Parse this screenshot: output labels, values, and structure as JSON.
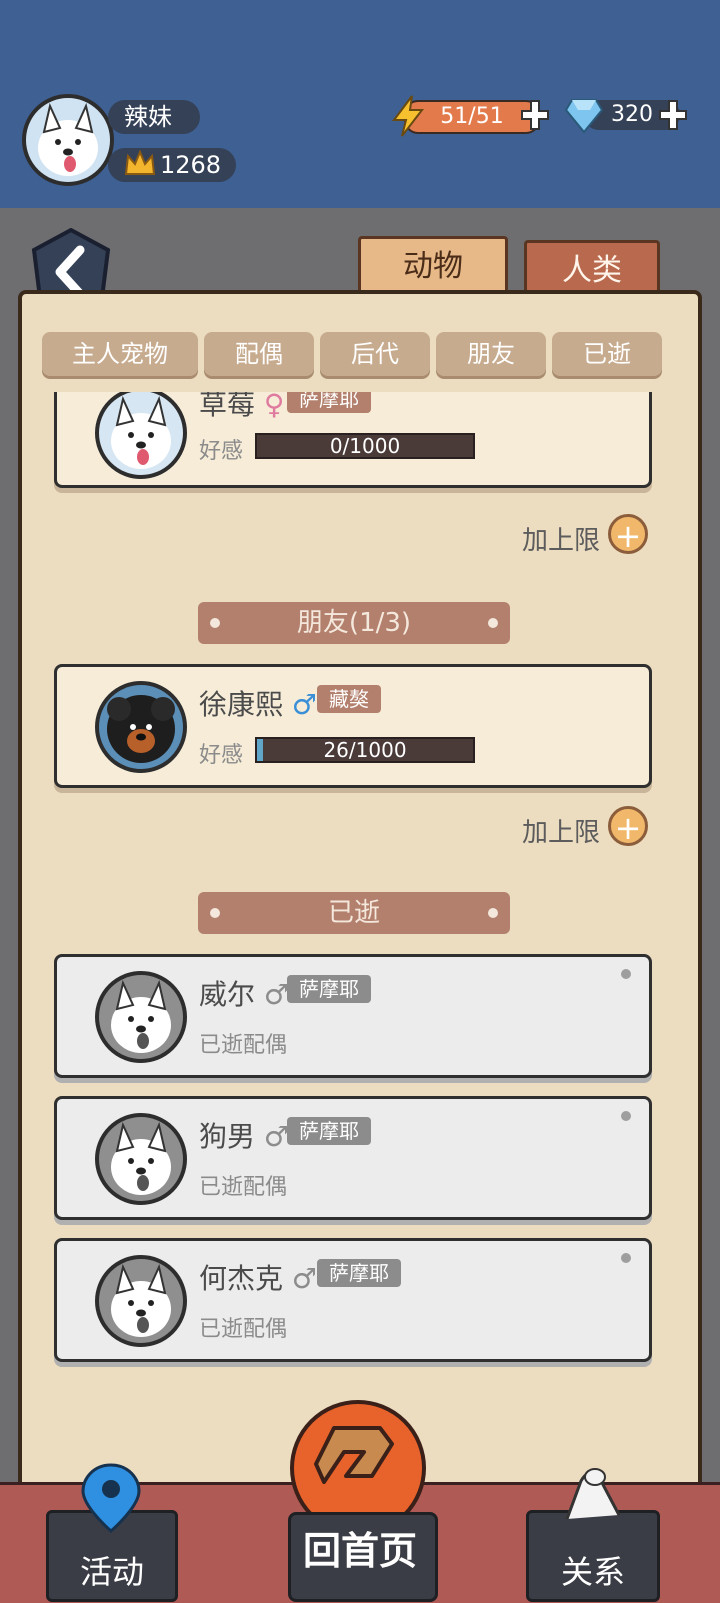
{
  "header": {
    "player_name": "辣妹",
    "crown_score": "1268",
    "energy": "51/51",
    "diamonds": "320"
  },
  "top_tabs": [
    {
      "label": "动物",
      "active": true
    },
    {
      "label": "人类",
      "active": false
    }
  ],
  "sub_tabs": [
    "主人宠物",
    "配偶",
    "后代",
    "朋友",
    "已逝"
  ],
  "spouse_section": {
    "card": {
      "name": "草莓",
      "gender": "♀",
      "breed": "萨摩耶",
      "affinity_label": "好感",
      "affinity": "0/1000",
      "affinity_fraction": 0.0
    },
    "add_max_label": "加上限"
  },
  "friends_section": {
    "title": "朋友(1/3)",
    "card": {
      "name": "徐康熙",
      "gender": "♂",
      "breed": "藏獒",
      "affinity_label": "好感",
      "affinity": "26/1000",
      "affinity_fraction": 0.026
    },
    "add_max_label": "加上限"
  },
  "deceased_section": {
    "title": "已逝",
    "cards": [
      {
        "name": "威尔",
        "gender": "♂",
        "breed": "萨摩耶",
        "status": "已逝配偶"
      },
      {
        "name": "狗男",
        "gender": "♂",
        "breed": "萨摩耶",
        "status": "已逝配偶"
      },
      {
        "name": "何杰克",
        "gender": "♂",
        "breed": "萨摩耶",
        "status": "已逝配偶"
      }
    ]
  },
  "bottom_nav": {
    "activity": "活动",
    "home": "回首页",
    "relations": "关系"
  },
  "colors": {
    "header_bg": "#3f6092",
    "parchment": "#ecdcc0",
    "female": "#e07ba0",
    "male": "#3a8fd6",
    "breed_alive": "#b3806d",
    "breed_dead": "#8c8c8c"
  }
}
